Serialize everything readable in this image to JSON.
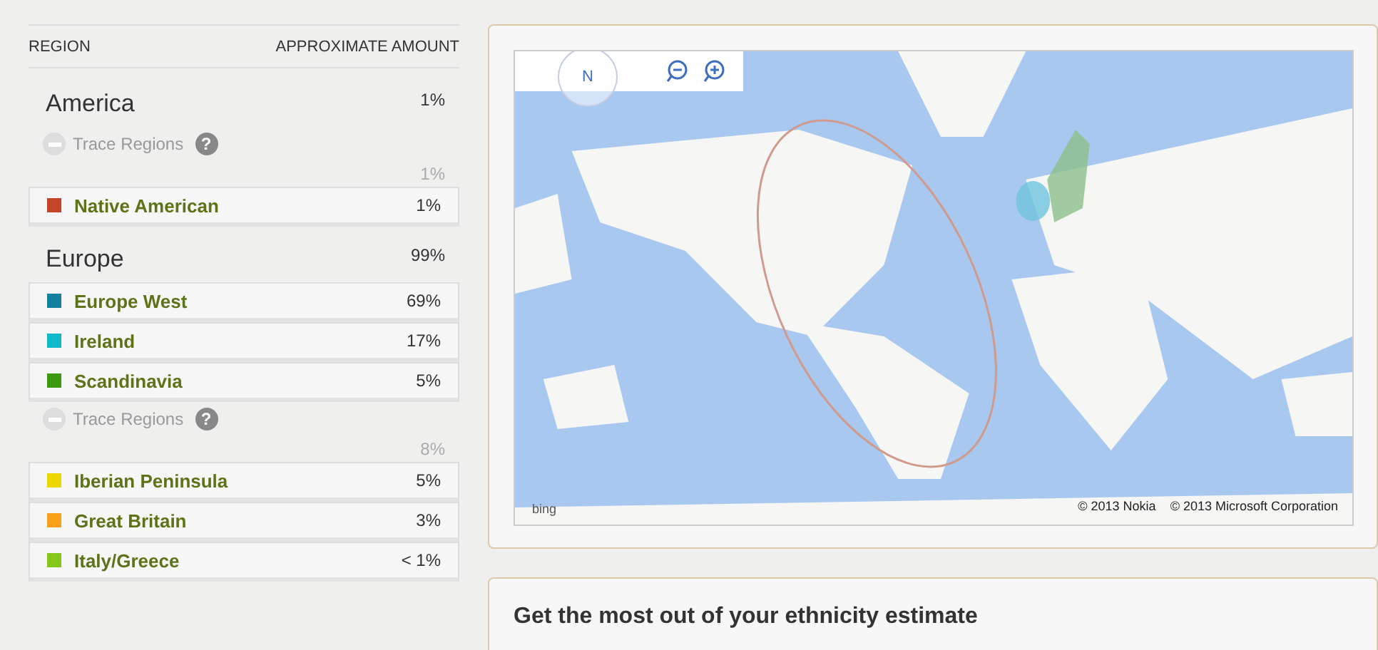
{
  "table": {
    "columns": [
      "REGION",
      "APPROXIMATE AMOUNT"
    ],
    "groups": [
      {
        "name": "America",
        "percent": "1%",
        "items": [
          {
            "kind": "trace",
            "label": "Trace Regions",
            "help": "?",
            "percent": "1%"
          },
          {
            "kind": "region",
            "name": "Native American",
            "percent": "1%",
            "color": "#c4442a"
          }
        ]
      },
      {
        "name": "Europe",
        "percent": "99%",
        "items": [
          {
            "kind": "region",
            "name": "Europe West",
            "percent": "69%",
            "color": "#12809e"
          },
          {
            "kind": "region",
            "name": "Ireland",
            "percent": "17%",
            "color": "#12b8cc"
          },
          {
            "kind": "region",
            "name": "Scandinavia",
            "percent": "5%",
            "color": "#3d9a0e"
          },
          {
            "kind": "trace",
            "label": "Trace Regions",
            "help": "?",
            "percent": "8%"
          },
          {
            "kind": "region",
            "name": "Iberian Peninsula",
            "percent": "5%",
            "color": "#ecd800"
          },
          {
            "kind": "region",
            "name": "Great Britain",
            "percent": "3%",
            "color": "#f9a11b"
          },
          {
            "kind": "region",
            "name": "Italy/Greece",
            "percent": "< 1%",
            "color": "#84c81a"
          }
        ]
      }
    ]
  },
  "map": {
    "kind": "picture",
    "compass": "N",
    "credit_logo": "bing",
    "copyrights": [
      "© 2013 Nokia",
      "© 2013 Microsoft Corporation"
    ]
  },
  "info": {
    "heading": "Get the most out of your ethnicity estimate"
  }
}
